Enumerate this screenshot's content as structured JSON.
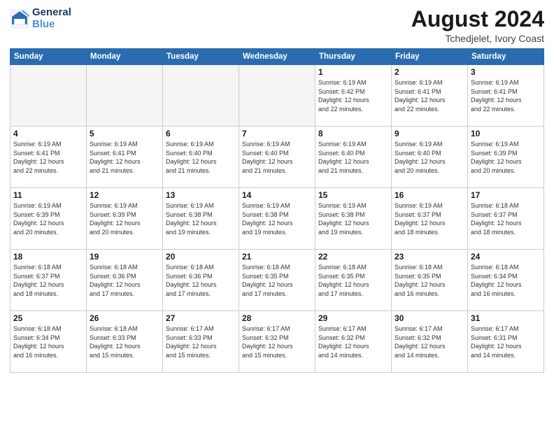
{
  "logo": {
    "line1": "General",
    "line2": "Blue"
  },
  "header": {
    "month": "August 2024",
    "location": "Tchedjelet, Ivory Coast"
  },
  "days_of_week": [
    "Sunday",
    "Monday",
    "Tuesday",
    "Wednesday",
    "Thursday",
    "Friday",
    "Saturday"
  ],
  "weeks": [
    [
      {
        "day": "",
        "detail": ""
      },
      {
        "day": "",
        "detail": ""
      },
      {
        "day": "",
        "detail": ""
      },
      {
        "day": "",
        "detail": ""
      },
      {
        "day": "1",
        "detail": "Sunrise: 6:19 AM\nSunset: 6:42 PM\nDaylight: 12 hours\nand 22 minutes."
      },
      {
        "day": "2",
        "detail": "Sunrise: 6:19 AM\nSunset: 6:41 PM\nDaylight: 12 hours\nand 22 minutes."
      },
      {
        "day": "3",
        "detail": "Sunrise: 6:19 AM\nSunset: 6:41 PM\nDaylight: 12 hours\nand 22 minutes."
      }
    ],
    [
      {
        "day": "4",
        "detail": "Sunrise: 6:19 AM\nSunset: 6:41 PM\nDaylight: 12 hours\nand 22 minutes."
      },
      {
        "day": "5",
        "detail": "Sunrise: 6:19 AM\nSunset: 6:41 PM\nDaylight: 12 hours\nand 21 minutes."
      },
      {
        "day": "6",
        "detail": "Sunrise: 6:19 AM\nSunset: 6:40 PM\nDaylight: 12 hours\nand 21 minutes."
      },
      {
        "day": "7",
        "detail": "Sunrise: 6:19 AM\nSunset: 6:40 PM\nDaylight: 12 hours\nand 21 minutes."
      },
      {
        "day": "8",
        "detail": "Sunrise: 6:19 AM\nSunset: 6:40 PM\nDaylight: 12 hours\nand 21 minutes."
      },
      {
        "day": "9",
        "detail": "Sunrise: 6:19 AM\nSunset: 6:40 PM\nDaylight: 12 hours\nand 20 minutes."
      },
      {
        "day": "10",
        "detail": "Sunrise: 6:19 AM\nSunset: 6:39 PM\nDaylight: 12 hours\nand 20 minutes."
      }
    ],
    [
      {
        "day": "11",
        "detail": "Sunrise: 6:19 AM\nSunset: 6:39 PM\nDaylight: 12 hours\nand 20 minutes."
      },
      {
        "day": "12",
        "detail": "Sunrise: 6:19 AM\nSunset: 6:39 PM\nDaylight: 12 hours\nand 20 minutes."
      },
      {
        "day": "13",
        "detail": "Sunrise: 6:19 AM\nSunset: 6:38 PM\nDaylight: 12 hours\nand 19 minutes."
      },
      {
        "day": "14",
        "detail": "Sunrise: 6:19 AM\nSunset: 6:38 PM\nDaylight: 12 hours\nand 19 minutes."
      },
      {
        "day": "15",
        "detail": "Sunrise: 6:19 AM\nSunset: 6:38 PM\nDaylight: 12 hours\nand 19 minutes."
      },
      {
        "day": "16",
        "detail": "Sunrise: 6:19 AM\nSunset: 6:37 PM\nDaylight: 12 hours\nand 18 minutes."
      },
      {
        "day": "17",
        "detail": "Sunrise: 6:18 AM\nSunset: 6:37 PM\nDaylight: 12 hours\nand 18 minutes."
      }
    ],
    [
      {
        "day": "18",
        "detail": "Sunrise: 6:18 AM\nSunset: 6:37 PM\nDaylight: 12 hours\nand 18 minutes."
      },
      {
        "day": "19",
        "detail": "Sunrise: 6:18 AM\nSunset: 6:36 PM\nDaylight: 12 hours\nand 17 minutes."
      },
      {
        "day": "20",
        "detail": "Sunrise: 6:18 AM\nSunset: 6:36 PM\nDaylight: 12 hours\nand 17 minutes."
      },
      {
        "day": "21",
        "detail": "Sunrise: 6:18 AM\nSunset: 6:35 PM\nDaylight: 12 hours\nand 17 minutes."
      },
      {
        "day": "22",
        "detail": "Sunrise: 6:18 AM\nSunset: 6:35 PM\nDaylight: 12 hours\nand 17 minutes."
      },
      {
        "day": "23",
        "detail": "Sunrise: 6:18 AM\nSunset: 6:35 PM\nDaylight: 12 hours\nand 16 minutes."
      },
      {
        "day": "24",
        "detail": "Sunrise: 6:18 AM\nSunset: 6:34 PM\nDaylight: 12 hours\nand 16 minutes."
      }
    ],
    [
      {
        "day": "25",
        "detail": "Sunrise: 6:18 AM\nSunset: 6:34 PM\nDaylight: 12 hours\nand 16 minutes."
      },
      {
        "day": "26",
        "detail": "Sunrise: 6:18 AM\nSunset: 6:33 PM\nDaylight: 12 hours\nand 15 minutes."
      },
      {
        "day": "27",
        "detail": "Sunrise: 6:17 AM\nSunset: 6:33 PM\nDaylight: 12 hours\nand 15 minutes."
      },
      {
        "day": "28",
        "detail": "Sunrise: 6:17 AM\nSunset: 6:32 PM\nDaylight: 12 hours\nand 15 minutes."
      },
      {
        "day": "29",
        "detail": "Sunrise: 6:17 AM\nSunset: 6:32 PM\nDaylight: 12 hours\nand 14 minutes."
      },
      {
        "day": "30",
        "detail": "Sunrise: 6:17 AM\nSunset: 6:32 PM\nDaylight: 12 hours\nand 14 minutes."
      },
      {
        "day": "31",
        "detail": "Sunrise: 6:17 AM\nSunset: 6:31 PM\nDaylight: 12 hours\nand 14 minutes."
      }
    ]
  ]
}
